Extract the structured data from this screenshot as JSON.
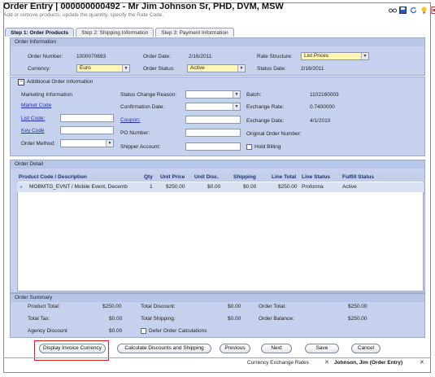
{
  "header": {
    "title": "Order Entry | 000000000492 - Mr Jim Johnson Sr, PHD, DVM, MSW",
    "subtitle": "Add or remove products, update the quantity, specify the Rate Code."
  },
  "tabs": [
    {
      "label": "Step 1: Order Products"
    },
    {
      "label": "Step 2: Shipping Information"
    },
    {
      "label": "Step 3: Payment Information"
    }
  ],
  "order_info": {
    "title": "Order Information",
    "order_number_label": "Order Number:",
    "order_number": "1000070693",
    "order_date_label": "Order Date:",
    "order_date": "2/16/2011",
    "rate_structure_label": "Rate Structure:",
    "rate_structure": "List Prices",
    "currency_label": "Currency:",
    "currency": "Euro",
    "order_status_label": "Order Status:",
    "order_status": "Active",
    "status_date_label": "Status Date:",
    "status_date": "2/16/2011"
  },
  "additional": {
    "title": "Additional Order Information",
    "marketing_info_label": "Marketing Information",
    "market_code_label": "Market Code",
    "list_code_label": "List Code:",
    "key_code_label": "Key Code",
    "order_method_label": "Order Method:",
    "status_change_reason_label": "Status Change Reason:",
    "confirmation_date_label": "Confirmation Date:",
    "coupon_label": "Coupon:",
    "po_number_label": "PO Number:",
    "shipper_account_label": "Shipper Account:",
    "batch_label": "Batch:",
    "batch": "1102160003",
    "exchange_rate_label": "Exchange Rate:",
    "exchange_rate": "0.7400000",
    "exchange_date_label": "Exchange Date:",
    "exchange_date": "4/1/2010",
    "original_order_label": "Original Order Number:",
    "hold_billing_label": "Hold Billing"
  },
  "detail": {
    "title": "Order Detail",
    "columns": [
      "Product Code / Description",
      "Qty",
      "Unit Price",
      "Unit Disc.",
      "Shipping",
      "Line Total",
      "Line Status",
      "Fulfill Status"
    ],
    "rows": [
      [
        "MOBMTG_EVNT / Mobile Event, Decemb",
        "1",
        "$250.00",
        "$0.00",
        "$0.00",
        "$250.00",
        "Proforma",
        "Active"
      ]
    ]
  },
  "summary": {
    "title": "Order Summary",
    "product_total_label": "Product Total:",
    "product_total": "$250.00",
    "total_tax_label": "Total Tax:",
    "total_tax": "$0.00",
    "agency_discount_label": "Agency Discount",
    "agency_discount": "$0.00",
    "total_discount_label": "Total Discount:",
    "total_discount": "$0.00",
    "total_shipping_label": "Total Shipping:",
    "total_shipping": "$0.00",
    "defer_label": "Defer Order Calculations",
    "order_total_label": "Order Total:",
    "order_total": "$250.00",
    "order_balance_label": "Order Balance:",
    "order_balance": "$250.00"
  },
  "buttons": {
    "display_invoice": "Display Invoice Currency",
    "calculate": "Calculate Discounts and Shipping",
    "previous": "Previous",
    "next": "Next",
    "save": "Save",
    "cancel": "Cancel"
  },
  "statusbar": {
    "currency_exchange": "Currency Exchange Rates",
    "active_item": "Johnson, Jim (Order Entry)"
  },
  "colors": {
    "panel": "#c6d2ed",
    "header_text": "#1d2f7a",
    "highlight": "#d81e1e",
    "yellow_field": "#fff6b8"
  }
}
